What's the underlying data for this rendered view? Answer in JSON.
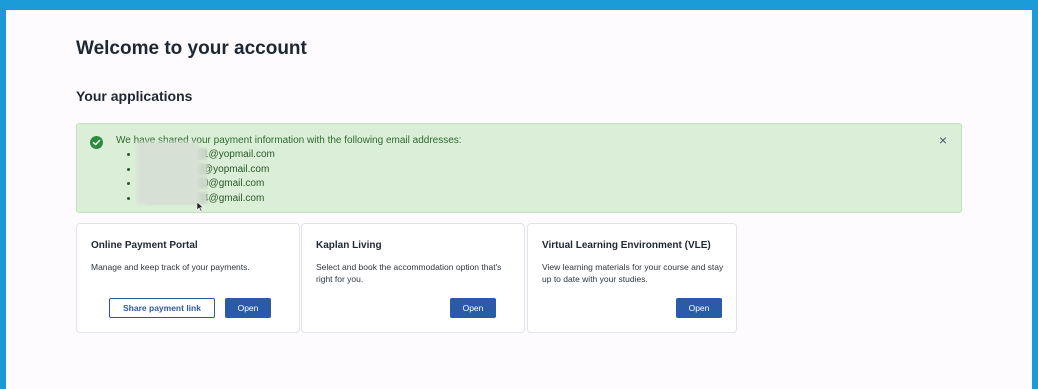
{
  "page": {
    "title": "Welcome to your account",
    "section_title": "Your applications"
  },
  "alert": {
    "message": "We have shared your payment information with the following email addresses:",
    "emails": [
      "1@yopmail.com",
      "@yopmail.com",
      "0@gmail.com",
      "4@gmail.com"
    ],
    "close_label": "×",
    "icons": {
      "status": "check-circle-icon",
      "close": "close-icon"
    },
    "colors": {
      "background": "#dbeed8",
      "icon": "#2e8b3e"
    }
  },
  "cards": [
    {
      "title": "Online Payment Portal",
      "description": "Manage and keep track of your payments.",
      "share_label": "Share payment link",
      "open_label": "Open"
    },
    {
      "title": "Kaplan Living",
      "description": "Select and book the accommodation option that's right for you.",
      "open_label": "Open"
    },
    {
      "title": "Virtual Learning Environment (VLE)",
      "description": "View learning materials for your course and stay up to date with your studies.",
      "open_label": "Open"
    }
  ],
  "colors": {
    "primary": "#2b5aa8",
    "frame_border": "#1a9ad6"
  }
}
